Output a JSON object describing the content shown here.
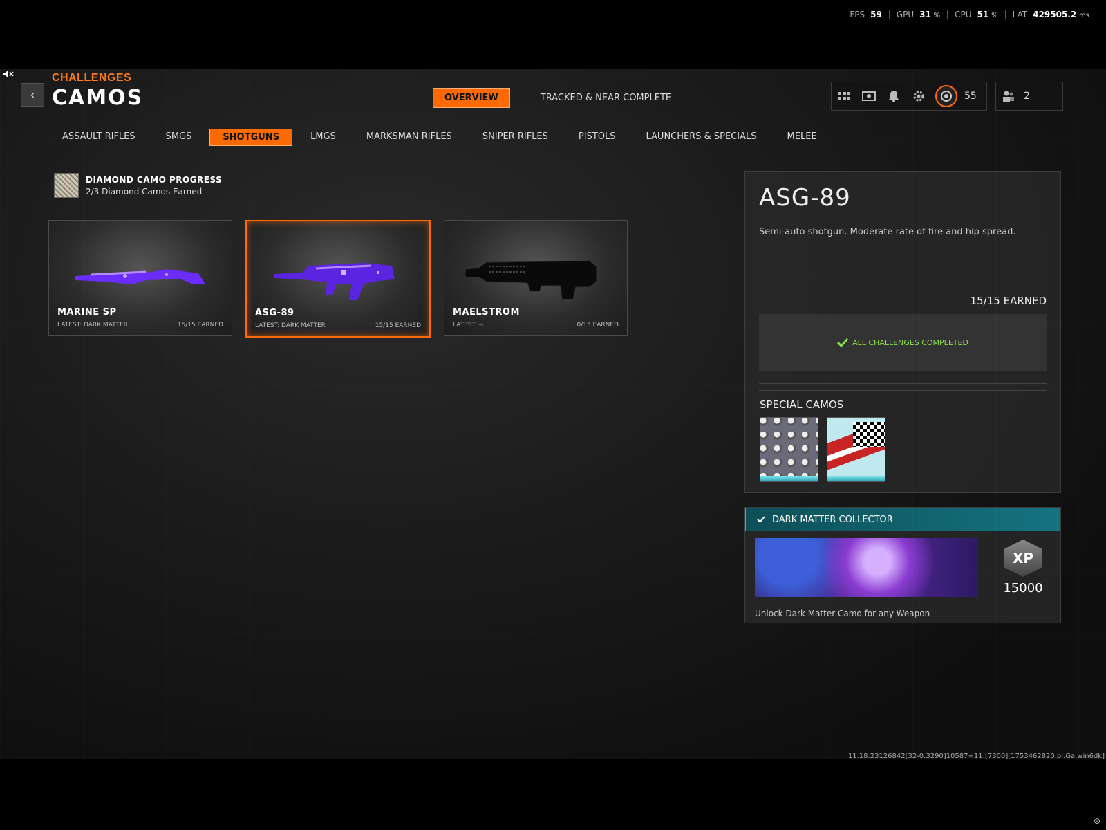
{
  "perf": {
    "fps_label": "FPS",
    "fps": "59",
    "gpu_label": "GPU",
    "gpu": "31",
    "gpu_unit": "%",
    "cpu_label": "CPU",
    "cpu": "51",
    "cpu_unit": "%",
    "lat_label": "LAT",
    "lat": "429505.2",
    "lat_unit": "ms"
  },
  "header": {
    "back_icon": "‹",
    "breadcrumb": "CHALLENGES",
    "title": "CAMOS",
    "mode_tabs": [
      "OVERVIEW",
      "TRACKED & NEAR COMPLETE"
    ],
    "active_mode": 0,
    "hud_count": "55",
    "party_count": "2"
  },
  "weapon_tabs": [
    "ASSAULT RIFLES",
    "SMGS",
    "SHOTGUNS",
    "LMGS",
    "MARKSMAN RIFLES",
    "SNIPER RIFLES",
    "PISTOLS",
    "LAUNCHERS & SPECIALS",
    "MELEE"
  ],
  "active_weapon_tab": 2,
  "diamond": {
    "title": "DIAMOND CAMO PROGRESS",
    "subtitle": "2/3 Diamond Camos Earned"
  },
  "cards": [
    {
      "name": "MARINE SP",
      "latest": "LATEST: DARK MATTER",
      "earned": "15/15 EARNED"
    },
    {
      "name": "ASG-89",
      "latest": "LATEST: DARK MATTER",
      "earned": "15/15 EARNED"
    },
    {
      "name": "MAELSTROM",
      "latest": "LATEST: --",
      "earned": "0/15 EARNED"
    }
  ],
  "detail": {
    "weapon_name": "ASG-89",
    "description": "Semi-auto shotgun.  Moderate rate of fire and hip spread.",
    "earned": "15/15 EARNED",
    "complete_text": "ALL CHALLENGES COMPLETED",
    "special_title": "SPECIAL CAMOS"
  },
  "dark_matter": {
    "title": "DARK MATTER COLLECTOR",
    "xp_label": "XP",
    "xp_value": "15000",
    "description": "Unlock Dark Matter Camo for any Weapon"
  },
  "build_string": "11.18.23126842[32-0.3290]10587+11:[7300][1753462820.pl.Ga.win6dk]",
  "colors": {
    "accent": "#ff6a00",
    "success": "#8be04a",
    "teal": "#157380"
  }
}
